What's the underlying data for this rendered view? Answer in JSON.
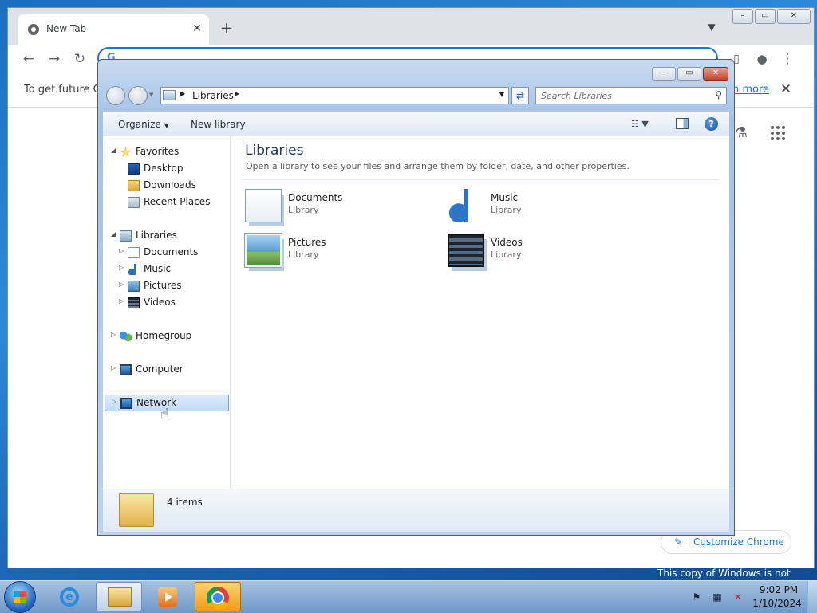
{
  "chrome": {
    "tab_title": "New Tab",
    "tab_close": "✕",
    "new_tab": "+",
    "infobar_text": "To get future Go",
    "infobar_link": "n more",
    "infobar_close": "✕",
    "customize_label": "Customize Chrome",
    "customize_icon": "pencil-icon",
    "omnibox_icon": "G"
  },
  "explorer": {
    "address": {
      "crumb": "Libraries"
    },
    "search_placeholder": "Search Libraries",
    "commands": {
      "organize": "Organize",
      "new_library": "New library",
      "help": "?"
    },
    "nav": {
      "favorites": {
        "label": "Favorites",
        "items": [
          "Desktop",
          "Downloads",
          "Recent Places"
        ]
      },
      "libraries": {
        "label": "Libraries",
        "items": [
          "Documents",
          "Music",
          "Pictures",
          "Videos"
        ]
      },
      "homegroup": "Homegroup",
      "computer": "Computer",
      "network": "Network"
    },
    "content": {
      "title": "Libraries",
      "subtitle": "Open a library to see your files and arrange them by folder, date, and other properties.",
      "items": [
        {
          "name": "Documents",
          "type": "Library",
          "icon": "documents-icon"
        },
        {
          "name": "Music",
          "type": "Library",
          "icon": "music-icon"
        },
        {
          "name": "Pictures",
          "type": "Library",
          "icon": "pictures-icon"
        },
        {
          "name": "Videos",
          "type": "Library",
          "icon": "videos-icon"
        }
      ]
    },
    "details": {
      "count": "4 items"
    }
  },
  "desktop": {
    "genuine_notice": "This copy of Windows is not genuine"
  },
  "taskbar": {
    "time": "9:02 PM",
    "date": "1/10/2024"
  },
  "colors": {
    "accent": "#1a73e8",
    "selection": "#c1dcf8",
    "title_blue": "#1e395b"
  }
}
